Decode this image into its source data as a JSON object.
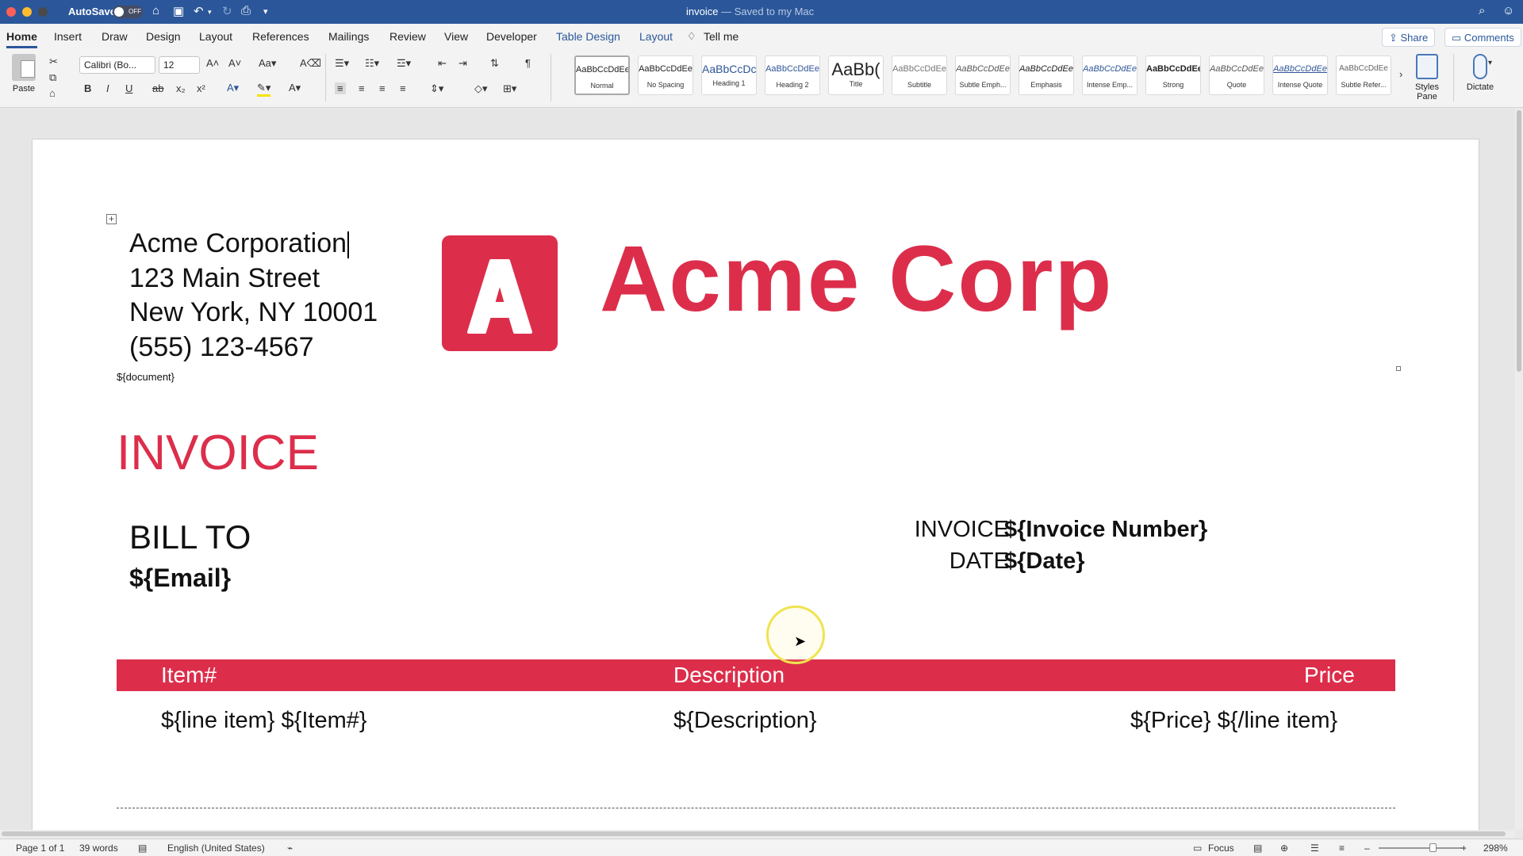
{
  "window": {
    "autosave_label": "AutoSave",
    "autosave_state": "OFF",
    "doc_name": "invoice",
    "save_status": "— Saved to my Mac"
  },
  "tabs": [
    "Home",
    "Insert",
    "Draw",
    "Design",
    "Layout",
    "References",
    "Mailings",
    "Review",
    "View",
    "Developer",
    "Table Design",
    "Layout"
  ],
  "tell_me": "Tell me",
  "share_label": "Share",
  "comments_label": "Comments",
  "ribbon": {
    "paste_label": "Paste",
    "font_name": "Calibri (Bo...",
    "font_size": "12",
    "styles": [
      {
        "sample": "AaBbCcDdEe",
        "name": "Normal"
      },
      {
        "sample": "AaBbCcDdEe",
        "name": "No Spacing"
      },
      {
        "sample": "AaBbCcDc",
        "name": "Heading 1"
      },
      {
        "sample": "AaBbCcDdEe",
        "name": "Heading 2"
      },
      {
        "sample": "AaBb(",
        "name": "Title"
      },
      {
        "sample": "AaBbCcDdEe",
        "name": "Subtitle"
      },
      {
        "sample": "AaBbCcDdEe",
        "name": "Subtle Emph..."
      },
      {
        "sample": "AaBbCcDdEe",
        "name": "Emphasis"
      },
      {
        "sample": "AaBbCcDdEe",
        "name": "Intense Emp..."
      },
      {
        "sample": "AaBbCcDdEe",
        "name": "Strong"
      },
      {
        "sample": "AaBbCcDdEe",
        "name": "Quote"
      },
      {
        "sample": "AaBbCcDdEe",
        "name": "Intense Quote"
      },
      {
        "sample": "AaBbCcDdEe",
        "name": "Subtle Refer..."
      }
    ],
    "styles_pane_label": "Styles Pane",
    "dictate_label": "Dictate"
  },
  "document": {
    "company": "Acme Corporation",
    "street": "123 Main Street",
    "city": "New York, NY 10001",
    "phone": "(555) 123-4567",
    "doc_tag": "${document}",
    "logo_letter": "A",
    "logo_text": "Acme Corp",
    "heading": "INVOICE",
    "bill_to": "BILL TO",
    "email": "${Email}",
    "invoice_label": "INVOICE",
    "invoice_value": "${Invoice Number}",
    "date_label": "DATE",
    "date_value": "${Date}",
    "table": {
      "headers": [
        "Item#",
        "Description",
        "Price"
      ],
      "row": [
        "${line item} ${Item#}",
        "${Description}",
        "${Price} ${/line item}"
      ]
    }
  },
  "status": {
    "page": "Page 1 of 1",
    "words": "39 words",
    "language": "English (United States)",
    "focus": "Focus",
    "zoom": "298%"
  },
  "colors": {
    "brand": "#dc2e4b",
    "titlebar": "#2b579a"
  }
}
